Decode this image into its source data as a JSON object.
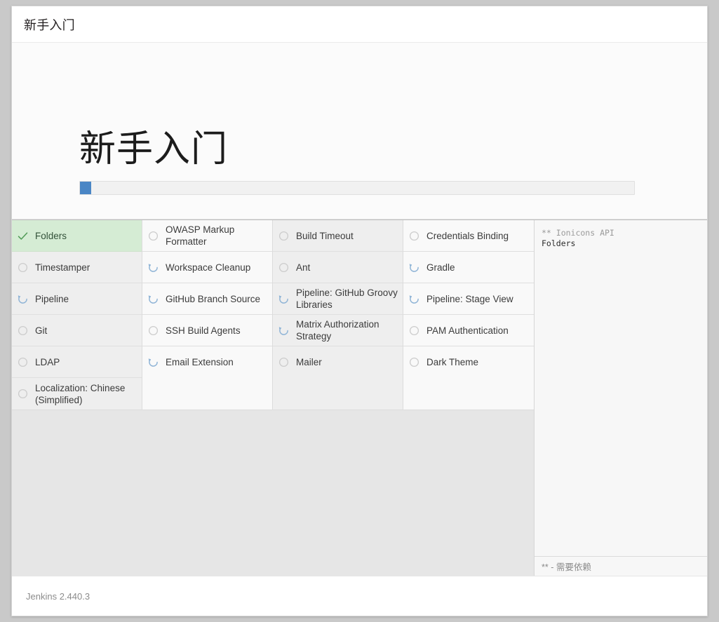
{
  "window": {
    "header_title": "新手入门"
  },
  "hero": {
    "title": "新手入门",
    "progress_percent": 2,
    "progress_fill_color": "#4a86c5",
    "progress_track_color": "#f1f1f1"
  },
  "install": {
    "success_bg_color": "#d5ecd4",
    "success_check_color": "#4f9a55",
    "pending_circle_color": "#cccccc",
    "spinner_color": "#8fb4d6",
    "columns": [
      {
        "plugins": [
          {
            "name": "Folders",
            "state": "success"
          },
          {
            "name": "Timestamper",
            "state": "pending"
          },
          {
            "name": "Pipeline",
            "state": "installing"
          },
          {
            "name": "Git",
            "state": "pending"
          },
          {
            "name": "LDAP",
            "state": "pending"
          },
          {
            "name": "Localization: Chinese (Simplified)",
            "state": "pending"
          }
        ]
      },
      {
        "plugins": [
          {
            "name": "OWASP Markup Formatter",
            "state": "pending"
          },
          {
            "name": "Workspace Cleanup",
            "state": "installing"
          },
          {
            "name": "GitHub Branch Source",
            "state": "installing"
          },
          {
            "name": "SSH Build Agents",
            "state": "pending"
          },
          {
            "name": "Email Extension",
            "state": "installing"
          }
        ]
      },
      {
        "plugins": [
          {
            "name": "Build Timeout",
            "state": "pending"
          },
          {
            "name": "Ant",
            "state": "pending"
          },
          {
            "name": "Pipeline: GitHub Groovy Libraries",
            "state": "installing"
          },
          {
            "name": "Matrix Authorization Strategy",
            "state": "installing"
          },
          {
            "name": "Mailer",
            "state": "pending"
          }
        ]
      },
      {
        "plugins": [
          {
            "name": "Credentials Binding",
            "state": "pending"
          },
          {
            "name": "Gradle",
            "state": "installing"
          },
          {
            "name": "Pipeline: Stage View",
            "state": "installing"
          },
          {
            "name": "PAM Authentication",
            "state": "pending"
          },
          {
            "name": "Dark Theme",
            "state": "pending"
          }
        ]
      }
    ]
  },
  "log": {
    "lines": [
      {
        "text": "** Ionicons API",
        "kind": "dep"
      },
      {
        "text": "Folders",
        "kind": "item"
      }
    ],
    "legend": "** - 需要依赖"
  },
  "footer": {
    "version": "Jenkins 2.440.3"
  }
}
